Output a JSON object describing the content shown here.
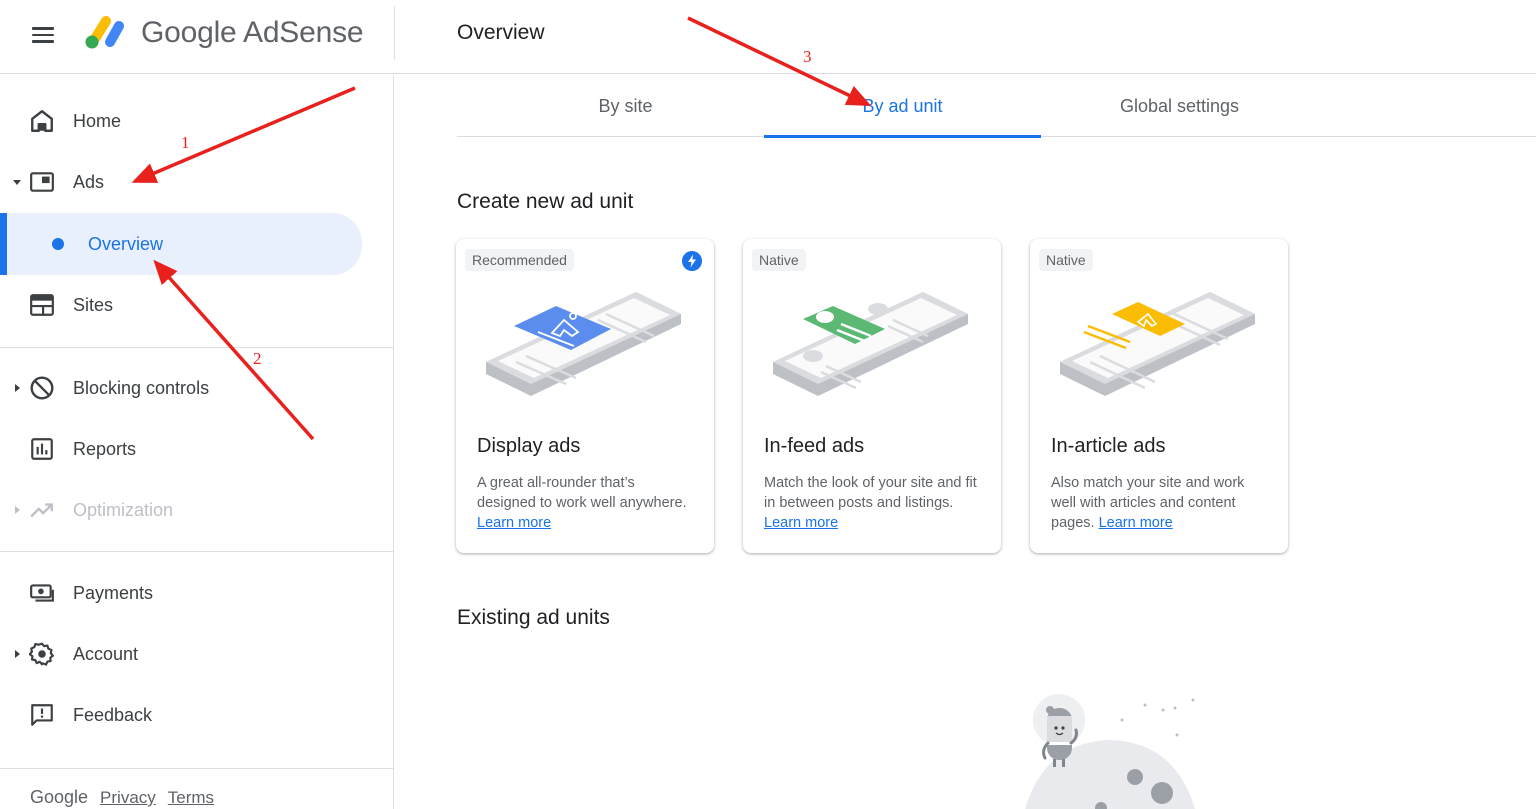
{
  "header": {
    "menu_icon": "hamburger-menu-icon",
    "logo_text": "Google AdSense",
    "page_title": "Overview"
  },
  "sidebar": {
    "items": [
      {
        "label": "Home",
        "icon": "home-icon",
        "expandable": false,
        "disabled": false
      },
      {
        "label": "Ads",
        "icon": "ad-unit-icon",
        "expandable": true,
        "expanded": true,
        "disabled": false
      },
      {
        "label": "Overview",
        "icon": "bullet-dot",
        "active": true,
        "sub_item": true
      },
      {
        "label": "Sites",
        "icon": "sites-icon",
        "expandable": false,
        "disabled": false
      },
      {
        "label": "Blocking controls",
        "icon": "block-icon",
        "expandable": true,
        "expanded": false,
        "disabled": false
      },
      {
        "label": "Reports",
        "icon": "reports-icon",
        "expandable": false,
        "disabled": false
      },
      {
        "label": "Optimization",
        "icon": "trending-up-icon",
        "expandable": true,
        "expanded": false,
        "disabled": true
      },
      {
        "label": "Payments",
        "icon": "payments-icon",
        "expandable": false,
        "disabled": false
      },
      {
        "label": "Account",
        "icon": "gear-icon",
        "expandable": true,
        "expanded": false,
        "disabled": false
      },
      {
        "label": "Feedback",
        "icon": "feedback-icon",
        "expandable": false,
        "disabled": false
      }
    ],
    "footer": {
      "brand": "Google",
      "links": [
        "Privacy",
        "Terms"
      ]
    }
  },
  "main": {
    "tabs": [
      {
        "label": "By site",
        "active": false
      },
      {
        "label": "By ad unit",
        "active": true
      },
      {
        "label": "Global settings",
        "active": false
      }
    ],
    "create_section_title": "Create new ad unit",
    "cards": [
      {
        "tag": "Recommended",
        "badge_icon": "lightning-bolt-icon",
        "title": "Display ads",
        "description": "A great all-rounder that’s designed to work well anywhere.",
        "link": "Learn more",
        "accent": "#5b8def"
      },
      {
        "tag": "Native",
        "title": "In-feed ads",
        "description": "Match the look of your site and fit in between posts and listings.",
        "link": "Learn more",
        "accent": "#5bb974"
      },
      {
        "tag": "Native",
        "title": "In-article ads",
        "description": "Also match your site and work well with articles and content pages.",
        "link": "Learn more",
        "accent": "#fbbc04"
      }
    ],
    "existing_section_title": "Existing ad units"
  },
  "annotations": [
    {
      "number": "1",
      "target": "Ads"
    },
    {
      "number": "2",
      "target": "Overview"
    },
    {
      "number": "3",
      "target": "By ad unit"
    }
  ],
  "colors": {
    "primary": "#1a73e8",
    "active_bg": "#e8f0fe",
    "annotation": "#e8211d"
  }
}
